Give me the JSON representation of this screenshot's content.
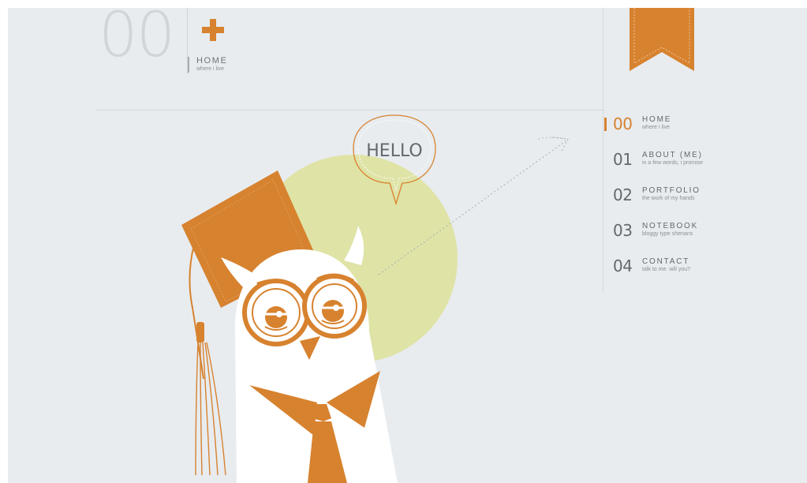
{
  "header": {
    "big_number": "00",
    "title": "HOME",
    "subtitle": "where i live"
  },
  "speech_bubble": "HELLO",
  "nav": {
    "items": [
      {
        "num": "00",
        "label": "HOME",
        "sub": "where i live",
        "active": true
      },
      {
        "num": "01",
        "label": "ABOUT (ME)",
        "sub": "in a few words, i promise",
        "active": false
      },
      {
        "num": "02",
        "label": "PORTFOLIO",
        "sub": "the work of my hands",
        "active": false
      },
      {
        "num": "03",
        "label": "NOTEBOOK",
        "sub": "bloggy type shenans",
        "active": false
      },
      {
        "num": "04",
        "label": "CONTACT",
        "sub": "talk to me. will you?",
        "active": false
      }
    ]
  },
  "colors": {
    "accent": "#d7822f",
    "background": "#e8ecef",
    "circle": "#dfe3a6",
    "text": "#63686c"
  },
  "icons": {
    "plus": "plus-icon",
    "ribbon": "bookmark-ribbon"
  }
}
